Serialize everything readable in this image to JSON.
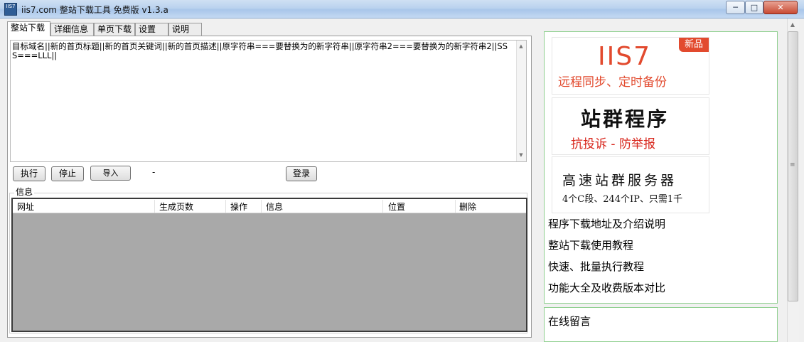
{
  "window": {
    "title": "iis7.com 整站下载工具 免费版  v1.3.a",
    "icon_text": "IIS7"
  },
  "tabs": [
    {
      "label": "整站下载",
      "active": true
    },
    {
      "label": "详细信息",
      "active": false
    },
    {
      "label": "单页下载",
      "active": false
    },
    {
      "label": "设置",
      "active": false
    },
    {
      "label": "说明",
      "active": false
    }
  ],
  "editor": {
    "text": "目标域名||新的首页标题||新的首页关键词||新的首页描述||原字符串===要替换为的新字符串||原字符串2===要替换为的新字符串2||SSS===LLL||"
  },
  "buttons": {
    "execute": "执行",
    "stop": "停止",
    "import": "导入",
    "separator": "-",
    "login": "登录"
  },
  "info_group": {
    "label": "信息",
    "columns": [
      "网址",
      "生成页数",
      "操作",
      "信息",
      "位置",
      "删除"
    ]
  },
  "ads": [
    {
      "logo": "IIS7",
      "badge": "新品",
      "tagline": "远程同步、定时备份",
      "accent": "#e24a2e"
    },
    {
      "logo": "站群程序",
      "tagline": "抗投诉 - 防举报",
      "accent": "#d8261c"
    },
    {
      "logo": "高速站群服务器",
      "tagline": "4个C段、244个IP、只需1千"
    }
  ],
  "links": [
    "程序下载地址及介绍说明",
    "整站下载使用教程",
    "快速、批量执行教程",
    "功能大全及收费版本对比"
  ],
  "online_message": "在线留言",
  "colors": {
    "panel_border": "#8fcf8f",
    "listview_bg": "#a9a9a9"
  }
}
